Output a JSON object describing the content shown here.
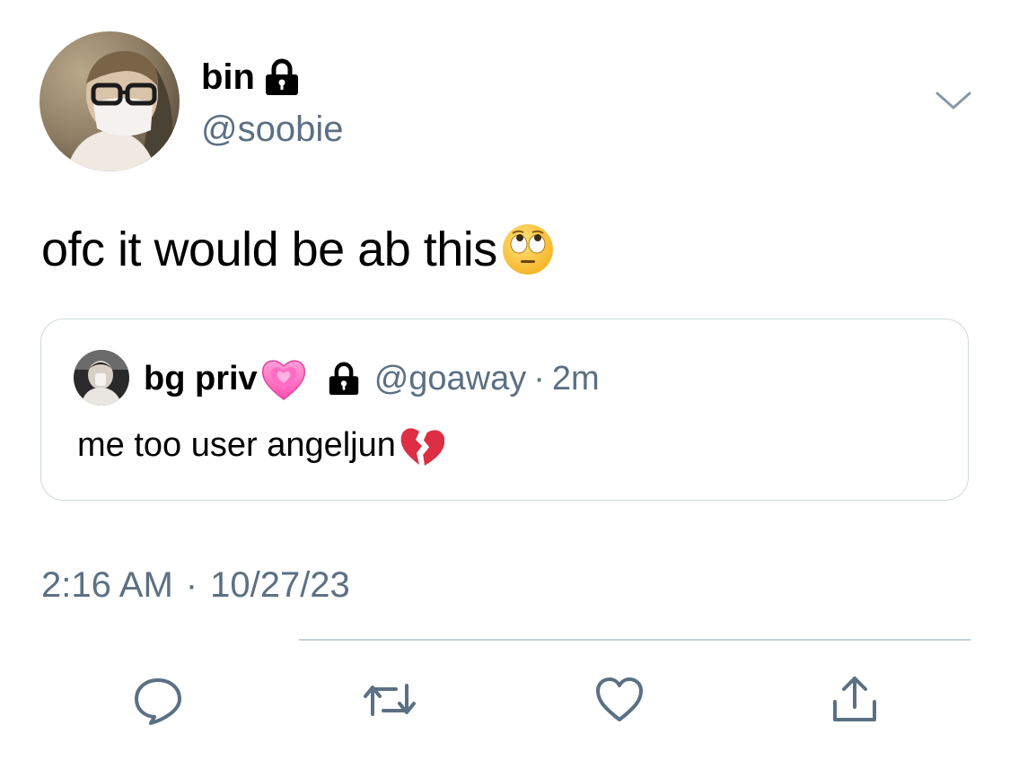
{
  "author": {
    "display_name": "bin",
    "handle": "@soobie",
    "avatar": "avatar-photo",
    "protected_icon": "lock-icon"
  },
  "tweet": {
    "text": "ofc it would be ab this",
    "emoji": "face-with-rolling-eyes",
    "timestamp_time": "2:16 AM",
    "timestamp_sep": "·",
    "timestamp_date": "10/27/23"
  },
  "quoted": {
    "display_name": "bg priv",
    "name_emoji": "growing-heart",
    "protected_icon": "lock-icon",
    "handle": "@goaway",
    "separator": "·",
    "time": "2m",
    "text": "me too user angeljun",
    "text_emoji": "broken-heart"
  },
  "actions": [
    "reply-icon",
    "retweet-icon",
    "like-icon",
    "share-icon"
  ],
  "menu_icon": "chevron-down-icon",
  "colors": {
    "text": "#000000",
    "secondary": "#5b7083",
    "border": "#cfd9de",
    "icon": "#5b7083"
  }
}
